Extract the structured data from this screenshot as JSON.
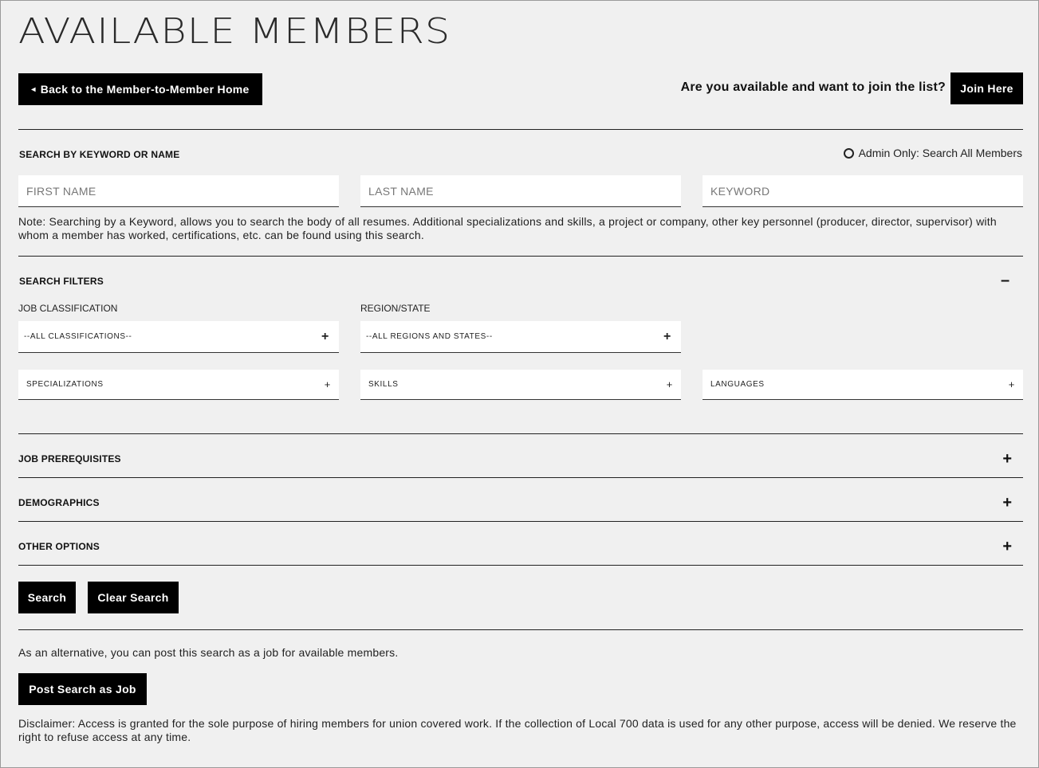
{
  "header": {
    "title": "AVAILABLE MEMBERS",
    "back_arrow": "◂",
    "back_label": "Back to the Member-to-Member Home",
    "join_prompt": "Are you available and want to join the list?",
    "join_label": "Join Here"
  },
  "keyword_search": {
    "heading": "SEARCH BY KEYWORD OR NAME",
    "admin_option_label": "Admin Only: Search All Members",
    "admin_option_checked": false,
    "first_name_placeholder": "FIRST NAME",
    "last_name_placeholder": "LAST NAME",
    "keyword_placeholder": "KEYWORD",
    "note": "Note: Searching by a Keyword, allows you to search the body of all resumes. Additional specializations and skills, a project or company, other key personnel (producer, director, supervisor) with whom a member has worked, certifications, etc. can be found using this search."
  },
  "filters": {
    "heading": "SEARCH FILTERS",
    "collapse_symbol": "–",
    "job_classification_label": "JOB CLASSIFICATION",
    "job_classification_value": "--ALL CLASSIFICATIONS--",
    "region_label": "REGION/STATE",
    "region_value": "--ALL REGIONS AND STATES--",
    "specializations_label": "SPECIALIZATIONS",
    "skills_label": "SKILLS",
    "languages_label": "LANGUAGES",
    "expand_symbol": "+"
  },
  "accordions": [
    {
      "label": "JOB PREREQUISITES",
      "symbol": "+"
    },
    {
      "label": "DEMOGRAPHICS",
      "symbol": "+"
    },
    {
      "label": "OTHER OPTIONS",
      "symbol": "+"
    }
  ],
  "actions": {
    "search_label": "Search",
    "clear_label": "Clear Search"
  },
  "post_job": {
    "text": "As an alternative, you can post this search as a job for available members.",
    "button_label": "Post Search as Job"
  },
  "disclaimer": "Disclaimer: Access is granted for the sole purpose of hiring members for union covered work. If the collection of Local 700 data is used for any other purpose, access will be denied. We reserve the right to refuse access at any time."
}
